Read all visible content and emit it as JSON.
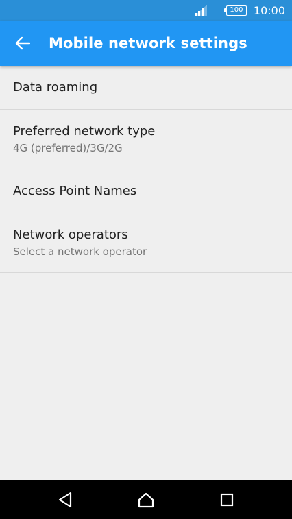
{
  "status_bar": {
    "battery_level": "100",
    "time": "10:00",
    "icons": [
      "signal-icon",
      "battery-icon"
    ]
  },
  "app_bar": {
    "title": "Mobile network settings",
    "back_icon": "arrow-left-icon"
  },
  "settings": [
    {
      "title": "Data roaming",
      "subtitle": ""
    },
    {
      "title": "Preferred network type",
      "subtitle": "4G (preferred)/3G/2G"
    },
    {
      "title": "Access Point Names",
      "subtitle": ""
    },
    {
      "title": "Network operators",
      "subtitle": "Select a network operator"
    }
  ],
  "nav_bar": {
    "icons": [
      "back-triangle-icon",
      "home-icon",
      "recents-icon"
    ]
  },
  "colors": {
    "status_bar": "#2a8fd7",
    "app_bar": "#2196f3",
    "background": "#efefef"
  }
}
